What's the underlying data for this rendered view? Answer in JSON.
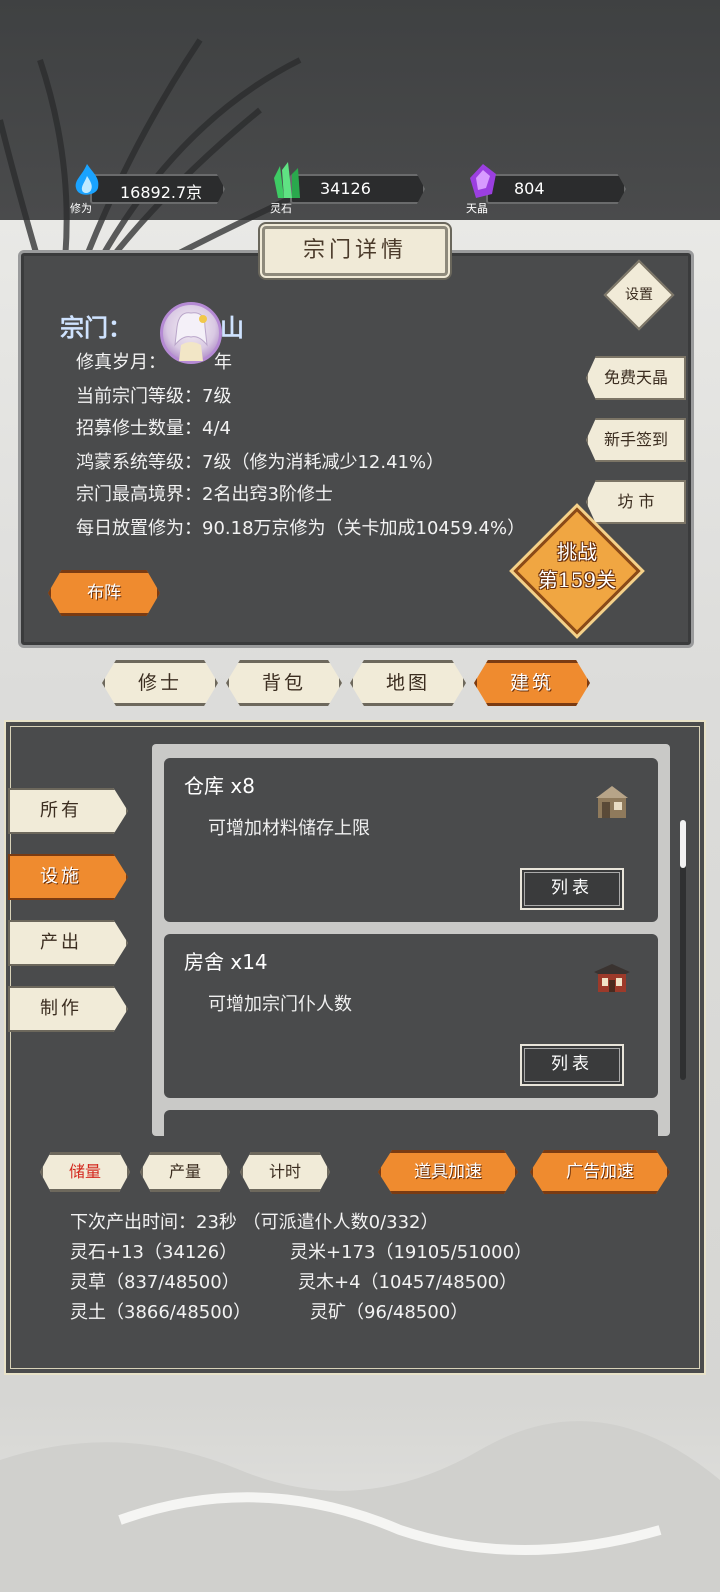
{
  "resources": [
    {
      "icon": "flame-icon",
      "label": "修为",
      "value": "16892.7京"
    },
    {
      "icon": "crystal-icon",
      "label": "灵石",
      "value": "34126"
    },
    {
      "icon": "gem-icon",
      "label": "天晶",
      "value": "804"
    }
  ],
  "panel_title": "宗门详情",
  "sect": {
    "label": "宗门：",
    "name_suffix": "山",
    "rows": [
      "修真岁月：",
      "当前宗门等级：7级",
      "招募修士数量：4/4",
      "鸿蒙系统等级：7级（修为消耗减少12.41%）",
      "宗门最高境界：2名出窍3阶修士",
      "每日放置修为：90.18万京修为（关卡加成10459.4%）"
    ],
    "years_suffix": "年"
  },
  "side_buttons": {
    "settings": "设置",
    "free_crystal": "免费天晶",
    "newbie_signin": "新手签到",
    "market": "坊 市"
  },
  "challenge": {
    "line1": "挑战",
    "line2": "第159关"
  },
  "formation_label": "布阵",
  "tabs": [
    {
      "label": "修士",
      "active": false
    },
    {
      "label": "背包",
      "active": false
    },
    {
      "label": "地图",
      "active": false
    },
    {
      "label": "建筑",
      "active": true
    }
  ],
  "categories": [
    {
      "label": "所有",
      "active": false
    },
    {
      "label": "设施",
      "active": true
    },
    {
      "label": "产出",
      "active": false
    },
    {
      "label": "制作",
      "active": false
    }
  ],
  "buildings": [
    {
      "name": "仓库",
      "count": "x8",
      "desc": "可增加材料储存上限",
      "button": "列表",
      "icon": "warehouse-icon"
    },
    {
      "name": "房舍",
      "count": "x14",
      "desc": "可增加宗门仆人数",
      "button": "列表",
      "icon": "house-icon"
    }
  ],
  "bottom_buttons": {
    "storage": "储量",
    "output": "产量",
    "timer": "计时",
    "item_speed": "道具加速",
    "ad_speed": "广告加速"
  },
  "stats": {
    "next_output": "下次产出时间：23秒 （可派遣仆人数0/332）",
    "spirit_stone": "灵石+13（34126）",
    "spirit_rice": "灵米+173（19105/51000）",
    "spirit_herb": "灵草（837/48500）",
    "spirit_wood": "灵木+4（10457/48500）",
    "spirit_soil": "灵土（3866/48500）",
    "spirit_ore": "灵矿（96/48500）"
  },
  "colors": {
    "accent_orange": "#ef8b2f",
    "panel_dark": "#4a4b4c",
    "button_cream": "#f1ebd8",
    "sect_name": "#cfe3ff"
  }
}
